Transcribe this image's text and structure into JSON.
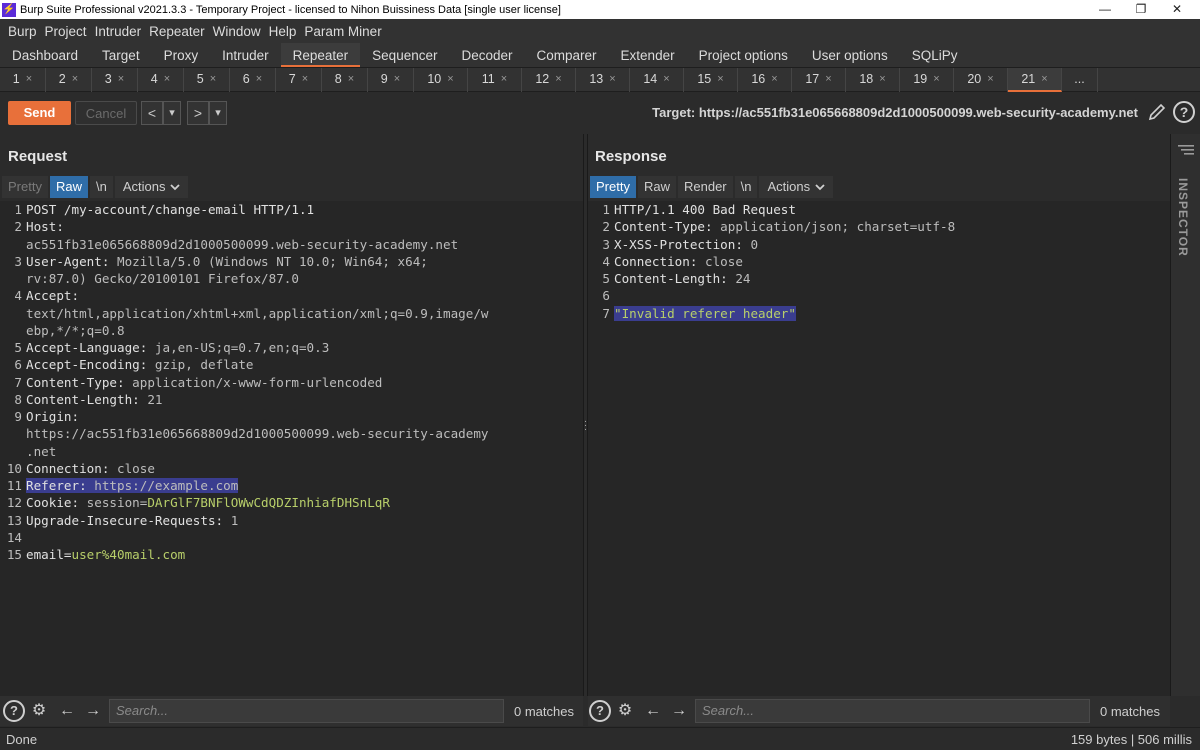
{
  "window": {
    "title": "Burp Suite Professional v2021.3.3 - Temporary Project - licensed to Nihon Buissiness Data [single user license]",
    "minimize": "—",
    "maximize": "❐",
    "close": "✕"
  },
  "menu": [
    "Burp",
    "Project",
    "Intruder",
    "Repeater",
    "Window",
    "Help",
    "Param Miner"
  ],
  "tool_tabs": [
    "Dashboard",
    "Target",
    "Proxy",
    "Intruder",
    "Repeater",
    "Sequencer",
    "Decoder",
    "Comparer",
    "Extender",
    "Project options",
    "User options",
    "SQLiPy"
  ],
  "active_tool_tab": "Repeater",
  "repeater_tabs": [
    "1",
    "2",
    "3",
    "4",
    "5",
    "6",
    "7",
    "8",
    "9",
    "10",
    "11",
    "12",
    "13",
    "14",
    "15",
    "16",
    "17",
    "18",
    "19",
    "20",
    "21"
  ],
  "active_repeater_tab": "21",
  "more_tabs": "...",
  "tab_close": "×",
  "toolbar": {
    "send_label": "Send",
    "cancel_label": "Cancel",
    "back": "<",
    "forward": ">",
    "dropdown": "▾",
    "target": "Target: https://ac551fb31e065668809d2d1000500099.web-security-academy.net",
    "help": "?"
  },
  "request": {
    "title": "Request",
    "tabs": [
      "Pretty",
      "Raw",
      "\\n"
    ],
    "active_tab": "Raw",
    "actions": "Actions",
    "lines": [
      {
        "n": "1",
        "parts": [
          {
            "t": "POST /my-account/change-email HTTP/1.1",
            "c": "hname"
          }
        ]
      },
      {
        "n": "2",
        "parts": [
          {
            "t": "Host:",
            "c": "hname"
          }
        ]
      },
      {
        "n": "",
        "parts": [
          {
            "t": "ac551fb31e065668809d2d1000500099.web-security-academy.net",
            "c": "hval"
          }
        ]
      },
      {
        "n": "3",
        "parts": [
          {
            "t": "User-Agent:",
            "c": "hname"
          },
          {
            "t": " Mozilla/5.0 (Windows NT 10.0; Win64; x64;",
            "c": "hval"
          }
        ]
      },
      {
        "n": "",
        "parts": [
          {
            "t": "rv:87.0) Gecko/20100101 Firefox/87.0",
            "c": "hval"
          }
        ]
      },
      {
        "n": "4",
        "parts": [
          {
            "t": "Accept:",
            "c": "hname"
          }
        ]
      },
      {
        "n": "",
        "parts": [
          {
            "t": "text/html,application/xhtml+xml,application/xml;q=0.9,image/w",
            "c": "hval"
          }
        ]
      },
      {
        "n": "",
        "parts": [
          {
            "t": "ebp,*/*;q=0.8",
            "c": "hval"
          }
        ]
      },
      {
        "n": "5",
        "parts": [
          {
            "t": "Accept-Language:",
            "c": "hname"
          },
          {
            "t": " ja,en-US;q=0.7,en;q=0.3",
            "c": "hval"
          }
        ]
      },
      {
        "n": "6",
        "parts": [
          {
            "t": "Accept-Encoding:",
            "c": "hname"
          },
          {
            "t": " gzip, deflate",
            "c": "hval"
          }
        ]
      },
      {
        "n": "7",
        "parts": [
          {
            "t": "Content-Type:",
            "c": "hname"
          },
          {
            "t": " application/x-www-form-urlencoded",
            "c": "hval"
          }
        ]
      },
      {
        "n": "8",
        "parts": [
          {
            "t": "Content-Length:",
            "c": "hname"
          },
          {
            "t": " 21",
            "c": "hval"
          }
        ]
      },
      {
        "n": "9",
        "parts": [
          {
            "t": "Origin:",
            "c": "hname"
          }
        ]
      },
      {
        "n": "",
        "parts": [
          {
            "t": "https://ac551fb31e065668809d2d1000500099.web-security-academy",
            "c": "hval"
          }
        ]
      },
      {
        "n": "",
        "parts": [
          {
            "t": ".net",
            "c": "hval"
          }
        ]
      },
      {
        "n": "10",
        "parts": [
          {
            "t": "Connection:",
            "c": "hname"
          },
          {
            "t": " close",
            "c": "hval"
          }
        ]
      },
      {
        "n": "11",
        "parts": [
          {
            "t": "Referer:",
            "c": "hname hl"
          },
          {
            "t": " https://example.com",
            "c": "hval hl"
          }
        ]
      },
      {
        "n": "12",
        "parts": [
          {
            "t": "Cookie:",
            "c": "hname"
          },
          {
            "t": " session=",
            "c": "hval"
          },
          {
            "t": "DArGlF7BNFlOWwCdQDZInhiafDHSnLqR",
            "c": "str"
          }
        ]
      },
      {
        "n": "13",
        "parts": [
          {
            "t": "Upgrade-Insecure-Requests:",
            "c": "hname"
          },
          {
            "t": " 1",
            "c": "hval"
          }
        ]
      },
      {
        "n": "14",
        "parts": []
      },
      {
        "n": "15",
        "parts": [
          {
            "t": "email=",
            "c": "hname"
          },
          {
            "t": "user%40mail.com",
            "c": "str"
          }
        ]
      }
    ],
    "search_placeholder": "Search...",
    "matches": "0 matches"
  },
  "response": {
    "title": "Response",
    "tabs": [
      "Pretty",
      "Raw",
      "Render",
      "\\n"
    ],
    "active_tab": "Pretty",
    "actions": "Actions",
    "lines": [
      {
        "n": "1",
        "parts": [
          {
            "t": "HTTP/1.1 400 Bad Request",
            "c": "hname"
          }
        ]
      },
      {
        "n": "2",
        "parts": [
          {
            "t": "Content-Type:",
            "c": "hname"
          },
          {
            "t": " application/json; charset=utf-8",
            "c": "hval"
          }
        ]
      },
      {
        "n": "3",
        "parts": [
          {
            "t": "X-XSS-Protection:",
            "c": "hname"
          },
          {
            "t": " 0",
            "c": "hval"
          }
        ]
      },
      {
        "n": "4",
        "parts": [
          {
            "t": "Connection:",
            "c": "hname"
          },
          {
            "t": " close",
            "c": "hval"
          }
        ]
      },
      {
        "n": "5",
        "parts": [
          {
            "t": "Content-Length:",
            "c": "hname"
          },
          {
            "t": " 24",
            "c": "hval"
          }
        ]
      },
      {
        "n": "6",
        "parts": []
      },
      {
        "n": "7",
        "parts": [
          {
            "t": "\"Invalid referer header\"",
            "c": "str hl"
          }
        ]
      }
    ],
    "search_placeholder": "Search...",
    "matches": "0 matches"
  },
  "inspector_label": "INSPECTOR",
  "status": {
    "left": "Done",
    "right": "159 bytes | 506 millis"
  },
  "colors": {
    "accent": "#e8703a",
    "active_tab_blue": "#2f6da8",
    "highlight": "#3a3d8f",
    "string_green": "#b8cf6a"
  }
}
